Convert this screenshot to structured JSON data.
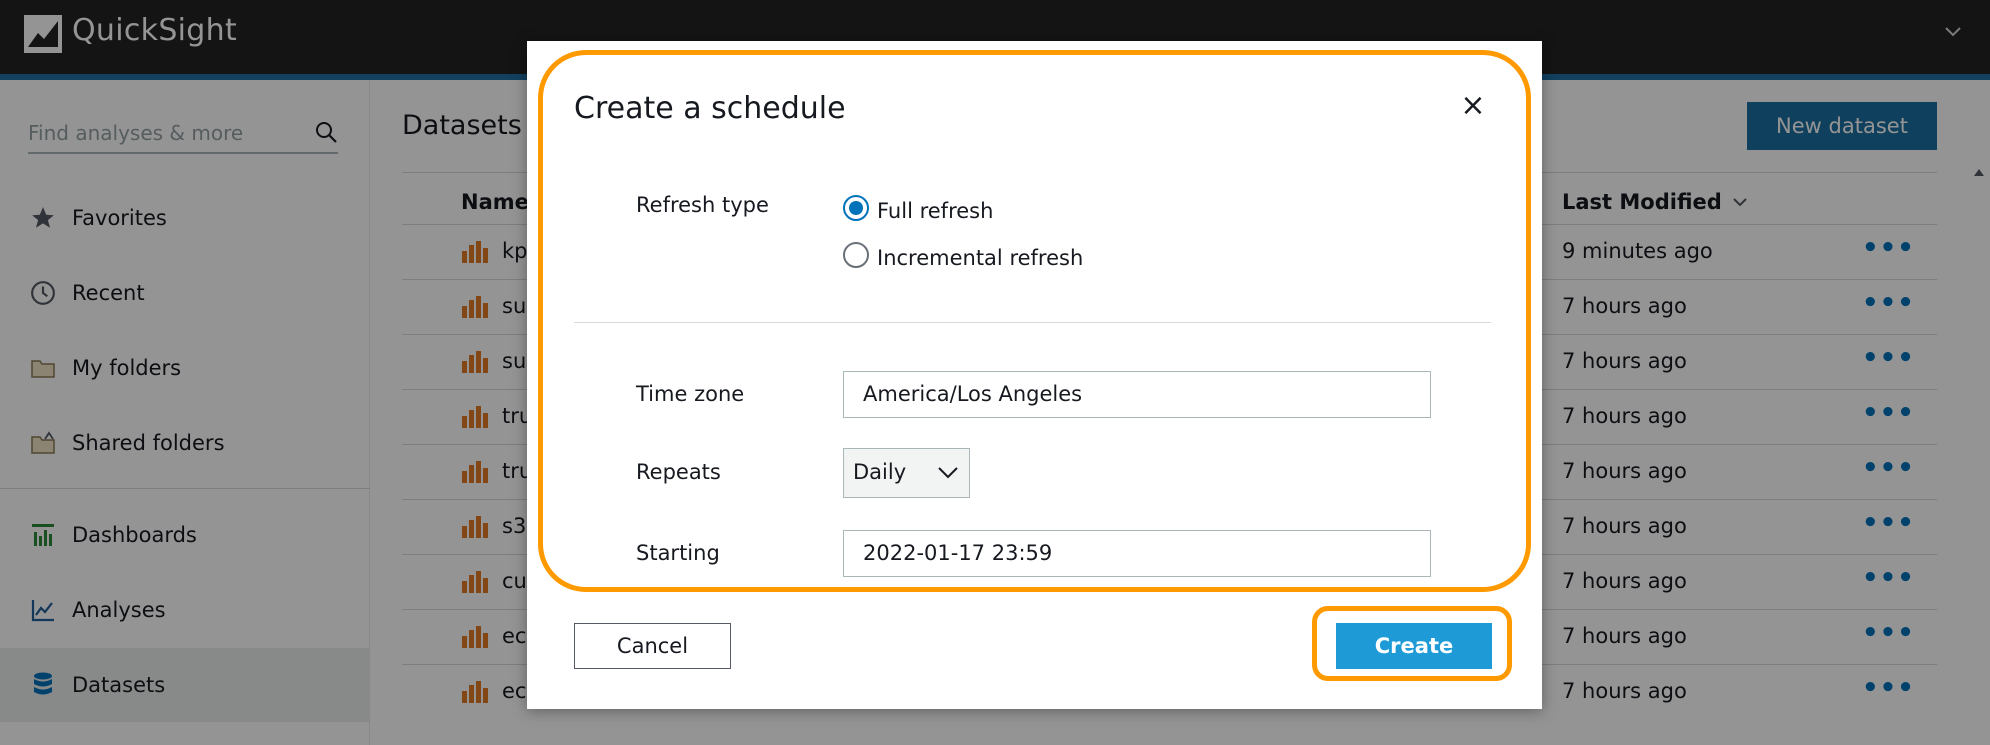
{
  "app": {
    "brand": "QuickSight"
  },
  "colors": {
    "accent": "#0073bb",
    "highlight": "#ff9900",
    "create_button": "#1e9bd7",
    "dataset_icon": "#e07b24"
  },
  "sidebar": {
    "search_placeholder": "Find analyses & more",
    "items": [
      {
        "label": "Favorites",
        "icon": "star-icon"
      },
      {
        "label": "Recent",
        "icon": "clock-icon"
      },
      {
        "label": "My folders",
        "icon": "folder-icon"
      },
      {
        "label": "Shared folders",
        "icon": "shared-folder-icon"
      },
      {
        "label": "Dashboards",
        "icon": "dashboard-icon"
      },
      {
        "label": "Analyses",
        "icon": "analysis-icon"
      },
      {
        "label": "Datasets",
        "icon": "database-icon",
        "active": true
      }
    ]
  },
  "main": {
    "title": "Datasets",
    "new_button": "New dataset",
    "columns": {
      "name": "Name",
      "last_modified": "Last Modified"
    },
    "rows": [
      {
        "name": "kp",
        "modified": "9 minutes ago"
      },
      {
        "name": "su",
        "modified": "7 hours ago"
      },
      {
        "name": "su",
        "modified": "7 hours ago"
      },
      {
        "name": "tru",
        "modified": "7 hours ago"
      },
      {
        "name": "tru",
        "modified": "7 hours ago"
      },
      {
        "name": "s3",
        "modified": "7 hours ago"
      },
      {
        "name": "cu",
        "modified": "7 hours ago"
      },
      {
        "name": "ec",
        "modified": "7 hours ago"
      },
      {
        "name": "ec",
        "modified": "7 hours ago"
      }
    ],
    "more_glyph": "•••"
  },
  "modal": {
    "title": "Create a schedule",
    "close": "×",
    "refresh_type_label": "Refresh type",
    "refresh_options": [
      {
        "label": "Full refresh",
        "selected": true
      },
      {
        "label": "Incremental refresh",
        "selected": false
      }
    ],
    "time_zone_label": "Time zone",
    "time_zone_value": "America/Los Angeles",
    "repeats_label": "Repeats",
    "repeats_value": "Daily",
    "starting_label": "Starting",
    "starting_value": "2022-01-17 23:59",
    "cancel_label": "Cancel",
    "create_label": "Create"
  }
}
